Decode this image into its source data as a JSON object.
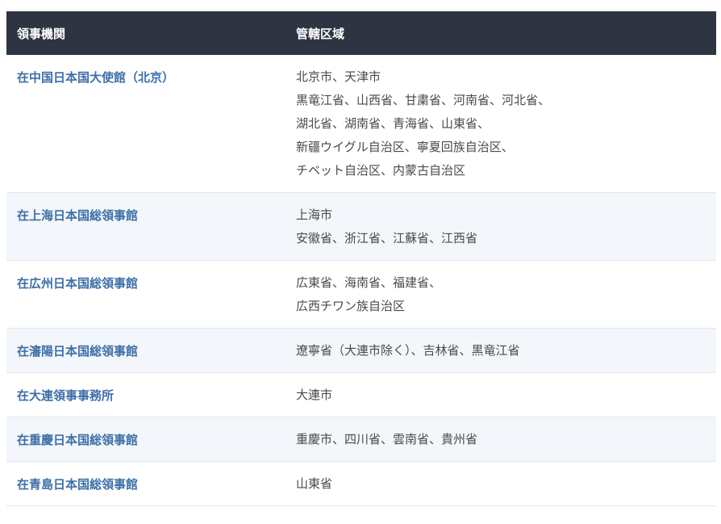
{
  "table": {
    "header": {
      "office": "領事機関",
      "jurisdiction": "管轄区域"
    },
    "rows": [
      {
        "office": "在中国日本国大使館（北京）",
        "lines": [
          "北京市、天津市",
          "黒竜江省、山西省、甘粛省、河南省、河北省、",
          "湖北省、湖南省、青海省、山東省、",
          "新疆ウイグル自治区、寧夏回族自治区、",
          "チベット自治区、内蒙古自治区"
        ]
      },
      {
        "office": "在上海日本国総領事館",
        "lines": [
          "上海市",
          "安徽省、浙江省、江蘇省、江西省"
        ]
      },
      {
        "office": "在広州日本国総領事館",
        "lines": [
          "広東省、海南省、福建省、",
          "広西チワン族自治区"
        ]
      },
      {
        "office": "在瀋陽日本国総領事館",
        "lines": [
          "遼寧省（大連市除く）、吉林省、黒竜江省"
        ]
      },
      {
        "office": "在大連領事事務所",
        "lines": [
          "大連市"
        ]
      },
      {
        "office": "在重慶日本国総領事館",
        "lines": [
          "重慶市、四川省、雲南省、貴州省"
        ]
      },
      {
        "office": "在青島日本国総領事館",
        "lines": [
          "山東省"
        ]
      }
    ]
  },
  "colors": {
    "header_bg": "#2e3442",
    "header_text": "#ffffff",
    "office_link": "#3d6fa8",
    "body_text": "#4a4a4a",
    "alt_row_bg": "#f3f6fa",
    "row_border": "#e3e6ea"
  }
}
